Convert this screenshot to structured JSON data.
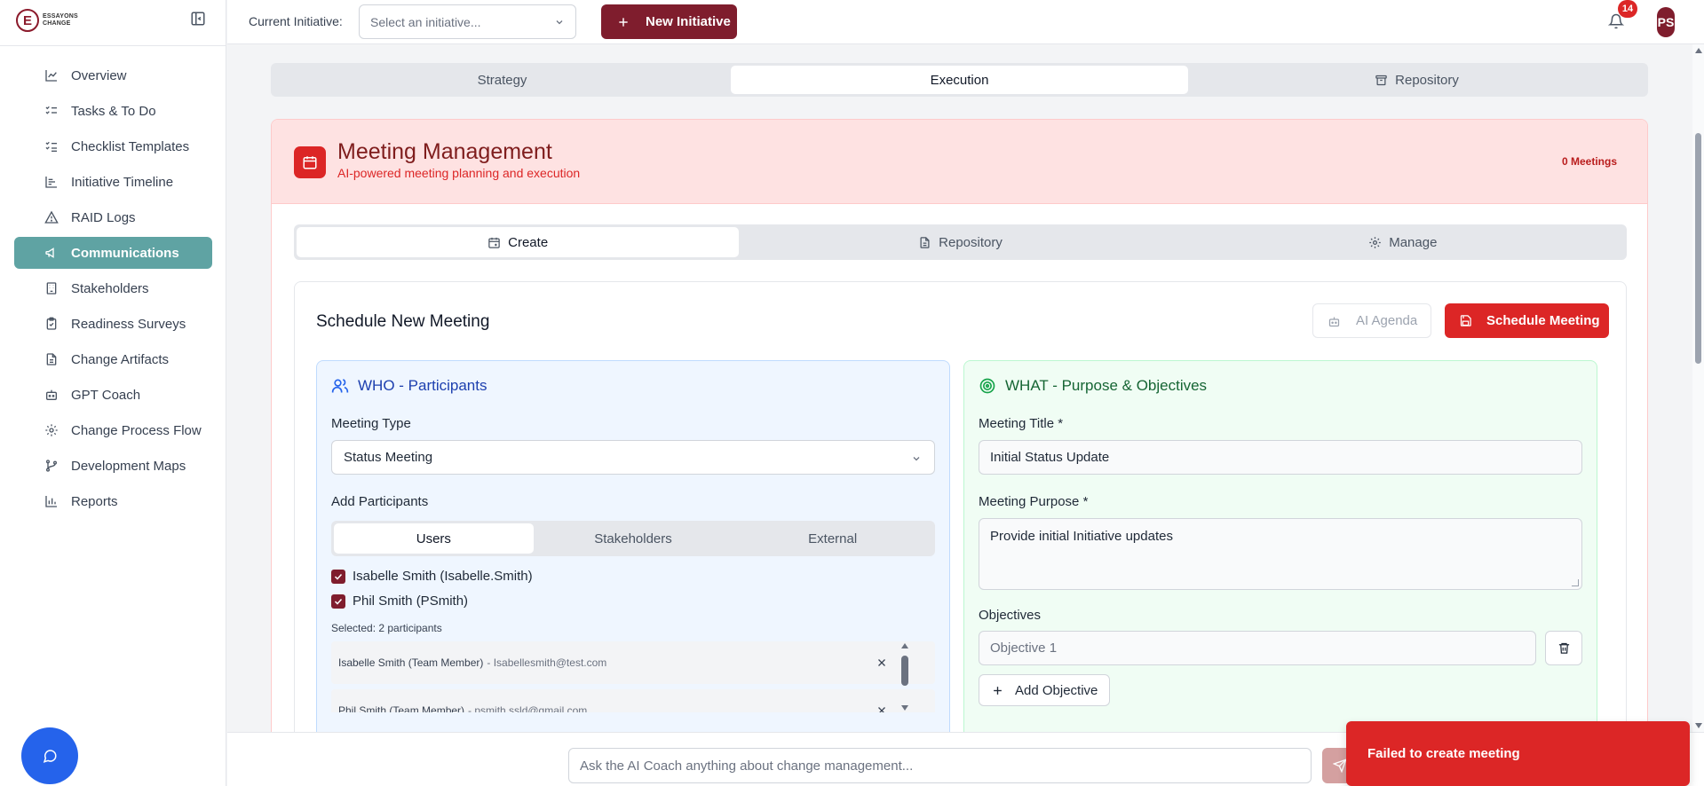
{
  "logo": {
    "line1": "ESSAYONS",
    "line2": "CHANGE"
  },
  "sidebar": {
    "items": [
      {
        "label": "Overview",
        "icon": "line-chart-icon"
      },
      {
        "label": "Tasks & To Do",
        "icon": "list-checks-icon"
      },
      {
        "label": "Checklist Templates",
        "icon": "list-checks-icon"
      },
      {
        "label": "Initiative Timeline",
        "icon": "timeline-icon"
      },
      {
        "label": "RAID Logs",
        "icon": "warning-triangle-icon"
      },
      {
        "label": "Communications",
        "icon": "megaphone-icon",
        "active": true
      },
      {
        "label": "Stakeholders",
        "icon": "building-icon"
      },
      {
        "label": "Readiness Surveys",
        "icon": "clipboard-icon"
      },
      {
        "label": "Change Artifacts",
        "icon": "document-icon"
      },
      {
        "label": "GPT Coach",
        "icon": "bot-icon"
      },
      {
        "label": "Change Process Flow",
        "icon": "workflow-icon"
      },
      {
        "label": "Development Maps",
        "icon": "git-branch-icon"
      },
      {
        "label": "Reports",
        "icon": "bar-chart-icon"
      }
    ]
  },
  "header": {
    "current_initiative_label": "Current Initiative:",
    "initiative_placeholder": "Select an initiative...",
    "new_initiative_label": "New Initiative",
    "notification_count": "14",
    "avatar_initials": "PS"
  },
  "main_tabs": [
    {
      "label": "Strategy",
      "active": false
    },
    {
      "label": "Execution",
      "active": true
    },
    {
      "label": "Repository",
      "active": false,
      "icon": "archive-icon"
    }
  ],
  "meeting_management": {
    "title": "Meeting Management",
    "subtitle": "AI-powered meeting planning and execution",
    "count": "0 Meetings",
    "tabs": [
      {
        "label": "Create",
        "icon": "calendar-plus-icon",
        "active": true
      },
      {
        "label": "Repository",
        "icon": "document-icon",
        "active": false
      },
      {
        "label": "Manage",
        "icon": "gear-icon",
        "active": false
      }
    ]
  },
  "schedule": {
    "title": "Schedule New Meeting",
    "ai_agenda_label": "AI Agenda",
    "schedule_label": "Schedule Meeting"
  },
  "who": {
    "title": "WHO - Participants",
    "meeting_type_label": "Meeting Type",
    "meeting_type_value": "Status Meeting",
    "add_participants_label": "Add Participants",
    "tabs": [
      "Users",
      "Stakeholders",
      "External"
    ],
    "checked_users": [
      "Isabelle Smith (Isabelle.Smith)",
      "Phil Smith (PSmith)"
    ],
    "selected_count": "Selected: 2 participants",
    "participants": [
      {
        "name": "Isabelle Smith (Team Member)",
        "email": "- Isabellesmith@test.com"
      },
      {
        "name": "Phil Smith (Team Member)",
        "email": "- psmith.ssld@gmail.com"
      }
    ]
  },
  "what": {
    "title": "WHAT - Purpose & Objectives",
    "meeting_title_label": "Meeting Title *",
    "meeting_title_value": "Initial Status Update",
    "purpose_label": "Meeting Purpose *",
    "purpose_value": "Provide initial Initiative updates",
    "objectives_label": "Objectives",
    "objective_placeholder": "Objective 1",
    "add_objective_label": "Add Objective"
  },
  "footer": {
    "coach_placeholder": "Ask the AI Coach anything about change management..."
  },
  "toast": {
    "message": "Failed to create meeting"
  },
  "colors": {
    "brand": "#7f1d2d",
    "active_nav": "#5fa3a3",
    "danger": "#dc2626",
    "who_bg": "#eff6ff",
    "what_bg": "#f0fdf4"
  }
}
